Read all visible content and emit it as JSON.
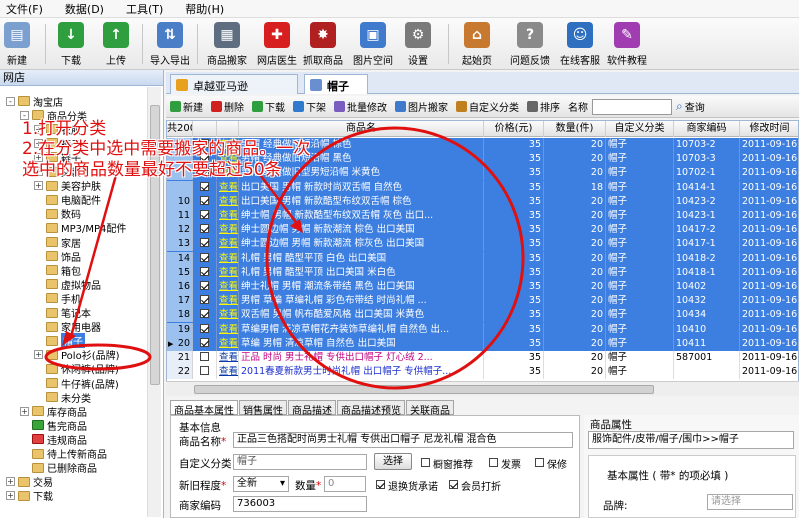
{
  "menubar": [
    "文件(F)",
    "数据(D)",
    "工具(T)",
    "帮助(H)"
  ],
  "toolbar": [
    {
      "label": "新建",
      "icon": "new-document-icon",
      "color": "#7b9fcf"
    },
    {
      "label": "下载",
      "icon": "download-icon",
      "color": "#2f9e3f"
    },
    {
      "label": "上传",
      "icon": "upload-icon",
      "color": "#2f9e3f"
    },
    {
      "label": "导入导出",
      "icon": "import-export-icon",
      "color": "#4a7fc7"
    },
    {
      "label": "商品搬家",
      "icon": "product-move-icon",
      "color": "#5f6d80"
    },
    {
      "label": "网店医生",
      "icon": "shop-doctor-icon",
      "color": "#d81f1f"
    },
    {
      "label": "抓取商品",
      "icon": "grab-product-icon",
      "color": "#b02020"
    },
    {
      "label": "图片空间",
      "icon": "image-space-icon",
      "color": "#3f7acc"
    },
    {
      "label": "设置",
      "icon": "settings-icon",
      "color": "#7a7a7a"
    },
    {
      "label": "起始页",
      "icon": "home-icon",
      "color": "#c87930"
    },
    {
      "label": "问题反馈",
      "icon": "feedback-icon",
      "color": "#8a8a8a"
    },
    {
      "label": "在线客服",
      "icon": "online-service-icon",
      "color": "#2f6fc0"
    },
    {
      "label": "软件教程",
      "icon": "tutorial-icon",
      "color": "#a03db0"
    }
  ],
  "leftpanel": {
    "title": "网店",
    "tree": [
      {
        "label": "淘宝店",
        "level": 0,
        "exp": "-",
        "kind": "shop"
      },
      {
        "label": "商品分类",
        "level": 1,
        "exp": "-",
        "kind": "folder"
      },
      {
        "label": "衣服",
        "level": 2,
        "exp": "+",
        "kind": "folder"
      },
      {
        "label": "裤子",
        "level": 2,
        "exp": "+",
        "kind": "folder"
      },
      {
        "label": "鞋子",
        "level": 2,
        "exp": "+",
        "kind": "folder"
      },
      {
        "label": "文装",
        "level": 2,
        "exp": "+",
        "kind": "folder"
      },
      {
        "label": "美容护肤",
        "level": 2,
        "exp": "+",
        "kind": "folder"
      },
      {
        "label": "电脑配件",
        "level": 2,
        "exp": "",
        "kind": "folder"
      },
      {
        "label": "数码",
        "level": 2,
        "exp": "",
        "kind": "folder"
      },
      {
        "label": "MP3/MP4配件",
        "level": 2,
        "exp": "",
        "kind": "folder"
      },
      {
        "label": "家居",
        "level": 2,
        "exp": "",
        "kind": "folder"
      },
      {
        "label": "饰品",
        "level": 2,
        "exp": "",
        "kind": "folder"
      },
      {
        "label": "箱包",
        "level": 2,
        "exp": "",
        "kind": "folder"
      },
      {
        "label": "虚拟物品",
        "level": 2,
        "exp": "",
        "kind": "folder"
      },
      {
        "label": "手机",
        "level": 2,
        "exp": "",
        "kind": "folder"
      },
      {
        "label": "笔记本",
        "level": 2,
        "exp": "",
        "kind": "folder"
      },
      {
        "label": "家用电器",
        "level": 2,
        "exp": "",
        "kind": "folder"
      },
      {
        "label": "帽子",
        "level": 2,
        "exp": "",
        "kind": "folder",
        "selected": true
      },
      {
        "label": "Polo衫(品牌)",
        "level": 2,
        "exp": "+",
        "kind": "folder"
      },
      {
        "label": "休闲裤(品牌)",
        "level": 2,
        "exp": "",
        "kind": "folder"
      },
      {
        "label": "牛仔裤(品牌)",
        "level": 2,
        "exp": "",
        "kind": "folder"
      },
      {
        "label": "未分类",
        "level": 2,
        "exp": "",
        "kind": "folder"
      },
      {
        "label": "库存商品",
        "level": 1,
        "exp": "+",
        "kind": "folder"
      },
      {
        "label": "售完商品",
        "level": 1,
        "exp": "",
        "kind": "green"
      },
      {
        "label": "违规商品",
        "level": 1,
        "exp": "",
        "kind": "red"
      },
      {
        "label": "待上传新商品",
        "level": 1,
        "exp": "",
        "kind": "folder"
      },
      {
        "label": "已删除商品",
        "level": 1,
        "exp": "",
        "kind": "folder"
      },
      {
        "label": "交易",
        "level": 0,
        "exp": "+",
        "kind": "folder"
      },
      {
        "label": "下载",
        "level": 0,
        "exp": "+",
        "kind": "folder"
      }
    ]
  },
  "tabs": [
    {
      "label": "卓越亚马逊",
      "icon": "amazon-icon",
      "color": "#e8a020",
      "active": false
    },
    {
      "label": "帽子",
      "icon": "hat-folder-icon",
      "color": "#6a8fd0",
      "active": true
    }
  ],
  "gridtools": {
    "items": [
      {
        "label": "新建",
        "icon": "add-icon",
        "color": "#2f9e3f"
      },
      {
        "label": "删除",
        "icon": "delete-icon",
        "color": "#d02020"
      },
      {
        "label": "下载",
        "icon": "download-icon",
        "color": "#2f9e3f"
      },
      {
        "label": "下架",
        "icon": "offshelf-icon",
        "color": "#2f7acc"
      },
      {
        "label": "批量修改",
        "icon": "batch-edit-icon",
        "color": "#7a5cc0"
      },
      {
        "label": "图片搬家",
        "icon": "image-move-icon",
        "color": "#3f7acc"
      },
      {
        "label": "自定义分类",
        "icon": "custom-category-icon",
        "color": "#c08020"
      },
      {
        "label": "排序",
        "icon": "sort-icon",
        "color": "#666666"
      }
    ],
    "search_label": "名称",
    "query_label": "查询"
  },
  "grid": {
    "columns": [
      "共200",
      "",
      "",
      "商品名",
      "价格(元)",
      "数量(件)",
      "自定义分类",
      "商家编码",
      "修改时间"
    ],
    "rows": [
      {
        "n": "",
        "sel": true,
        "link": "查看",
        "name": "男帽 经典做旧短沿帽 棕色",
        "price": "35",
        "qty": "20",
        "cat": "帽子",
        "code": "10703-2",
        "time": "2011-09-16..."
      },
      {
        "n": "",
        "sel": true,
        "link": "查看",
        "name": "男帽 经典做旧短沿帽 黑色",
        "price": "35",
        "qty": "20",
        "cat": "帽子",
        "code": "10703-3",
        "time": "2011-09-16..."
      },
      {
        "n": "",
        "sel": true,
        "link": "查看",
        "name": "男帽 经典做旧型男短沿帽 米黄色",
        "price": "35",
        "qty": "20",
        "cat": "帽子",
        "code": "10702-1",
        "time": "2011-09-16..."
      },
      {
        "n": "",
        "sel": true,
        "link": "查看",
        "name": "出口美国 男帽 新款时尚双舌帽 自然色",
        "price": "35",
        "qty": "18",
        "cat": "帽子",
        "code": "10414-1",
        "time": "2011-09-16..."
      },
      {
        "n": "10",
        "sel": true,
        "link": "查看",
        "name": "出口美国 男帽 新款酷型布纹双舌帽 棕色",
        "price": "35",
        "qty": "20",
        "cat": "帽子",
        "code": "10423-2",
        "time": "2011-09-16..."
      },
      {
        "n": "11",
        "sel": true,
        "link": "查看",
        "name": "绅士帽 男帽 新款酷型布纹双舌帽 灰色 出口...",
        "price": "35",
        "qty": "20",
        "cat": "帽子",
        "code": "10423-1",
        "time": "2011-09-16..."
      },
      {
        "n": "12",
        "sel": true,
        "link": "查看",
        "name": "绅士圆边帽 男帽 新款潮流 棕色 出口美国",
        "price": "35",
        "qty": "20",
        "cat": "帽子",
        "code": "10417-2",
        "time": "2011-09-16..."
      },
      {
        "n": "13",
        "sel": true,
        "link": "查看",
        "name": "绅士圆边帽 男帽 新款潮流 棕灰色 出口美国",
        "price": "35",
        "qty": "20",
        "cat": "帽子",
        "code": "10417-1",
        "time": "2011-09-16..."
      },
      {
        "n": "14",
        "sel": true,
        "link": "查看",
        "name": "礼帽 男帽 酷型平顶 白色 出口美国",
        "price": "35",
        "qty": "20",
        "cat": "帽子",
        "code": "10418-2",
        "time": "2011-09-16..."
      },
      {
        "n": "15",
        "sel": true,
        "link": "查看",
        "name": "礼帽 男帽 酷型平顶 出口美国 米白色",
        "price": "35",
        "qty": "20",
        "cat": "帽子",
        "code": "10418-1",
        "time": "2011-09-16..."
      },
      {
        "n": "16",
        "sel": true,
        "link": "查看",
        "name": "绅士礼帽 男帽 潮流条带结 黑色 出口美国",
        "price": "35",
        "qty": "20",
        "cat": "帽子",
        "code": "10402",
        "time": "2011-09-16..."
      },
      {
        "n": "17",
        "sel": true,
        "link": "查看",
        "name": "男帽 草编 草编礼帽 彩色布带结 时尚礼帽 ...",
        "price": "35",
        "qty": "20",
        "cat": "帽子",
        "code": "10432",
        "time": "2011-09-16..."
      },
      {
        "n": "18",
        "sel": true,
        "link": "查看",
        "name": "双舌帽 男帽 帆布酷爱风格 出口美国 米黄色",
        "price": "35",
        "qty": "20",
        "cat": "帽子",
        "code": "10434",
        "time": "2011-09-16..."
      },
      {
        "n": "19",
        "sel": true,
        "link": "查看",
        "name": "草编男帽 清凉草帽花卉装饰草编礼帽 自然色 出...",
        "price": "35",
        "qty": "20",
        "cat": "帽子",
        "code": "10410",
        "time": "2011-09-16..."
      },
      {
        "n": "20",
        "sel": true,
        "current": true,
        "link": "查看",
        "name": "草编 男帽 清凉草帽 自然色 出口美国",
        "price": "35",
        "qty": "20",
        "cat": "帽子",
        "code": "10411",
        "time": "2011-09-16..."
      },
      {
        "n": "21",
        "sel": false,
        "link": "查看",
        "name": "正品 时尚 男士礼帽 专供出口帽子 灯心绒 2...",
        "price": "35",
        "qty": "20",
        "cat": "帽子",
        "code": "587001",
        "time": "2011-09-16...",
        "style": "pink"
      },
      {
        "n": "22",
        "sel": false,
        "link": "查看",
        "name": "2011春夏新款男士时尚礼帽 出口帽子 专供帽子...",
        "price": "35",
        "qty": "20",
        "cat": "帽子",
        "code": "",
        "time": "2011-09-16...",
        "style": "blue"
      }
    ]
  },
  "prop_tabs": [
    "商品基本属性",
    "销售属性",
    "商品描述",
    "商品描述预览",
    "关联商品"
  ],
  "props": {
    "section": "基本信息",
    "name_label": "商品名称",
    "name_value": "正品三色搭配时尚男士礼帽 专供出口帽子 尼龙礼帽 混合色",
    "cat_label": "自定义分类",
    "cat_value": "帽子",
    "choose_btn": "选择",
    "cb_recommend": "橱窗推荐",
    "cb_invoice": "发票",
    "cb_warranty": "保修",
    "new_label": "新旧程度",
    "new_value": "全新",
    "qty_label": "数量",
    "qty_value": "0",
    "cb_return": "退换货承诺",
    "cb_vip": "会员打折",
    "code_label": "商家编码",
    "code_value": "736003"
  },
  "rprops": {
    "title": "商品属性",
    "path": "服饰配件/皮带/帽子/围巾>>帽子",
    "basic_label": "基本属性 ( 带* 的项必填 )",
    "brand_label": "品牌:",
    "brand_placeholder": "请选择"
  },
  "annotations": {
    "step1": "1.打开分类",
    "step2_line1": "2.在分类中选中需要搬家的商品。一次",
    "step2_line2": "选中的商品数量最好不要超过50条",
    "color": "#e01010"
  }
}
